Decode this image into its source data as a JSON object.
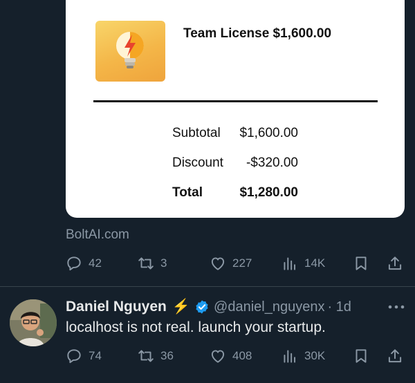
{
  "receipt": {
    "product_title": "Team License $1,600.00",
    "product_image_icon": "lightbulb-bolt-icon",
    "subtotal_label": "Subtotal",
    "subtotal_value": "$1,600.00",
    "discount_label": "Discount",
    "discount_value": "-$320.00",
    "total_label": "Total",
    "total_value": "$1,280.00"
  },
  "card_domain": "BoltAI.com",
  "tweet1_actions": {
    "replies": "42",
    "retweets": "3",
    "likes": "227",
    "views": "14K"
  },
  "tweet2": {
    "author_name": "Daniel Nguyen",
    "emoji": "⚡",
    "handle": "@daniel_nguyenx",
    "time": "· 1d",
    "text": "localhost is not real. launch your startup.",
    "actions": {
      "replies": "74",
      "retweets": "36",
      "likes": "408",
      "views": "30K"
    }
  },
  "colors": {
    "background": "#15202b",
    "muted_text": "#8b98a5",
    "primary_text": "#e7e9ea",
    "verified": "#1d9bf0"
  }
}
